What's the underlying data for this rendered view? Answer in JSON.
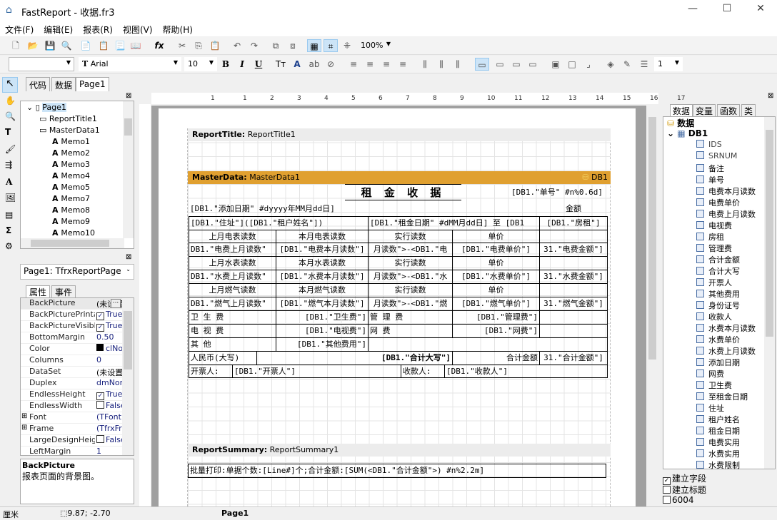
{
  "window": {
    "title": "FastReport - 收据.fr3"
  },
  "menu": [
    "文件(F)",
    "编辑(E)",
    "报表(R)",
    "视图(V)",
    "帮助(H)"
  ],
  "toolbar": {
    "zoom": "100%",
    "font_name": "Arial",
    "font_size": "10",
    "frame_width": "1",
    "style_value": ""
  },
  "doc_tabs": [
    "代码",
    "数据",
    "Page1"
  ],
  "tree": {
    "items": [
      "Page1",
      "ReportTitle1",
      "MasterData1",
      "Memo1",
      "Memo2",
      "Memo3",
      "Memo4",
      "Memo5",
      "Memo7",
      "Memo8",
      "Memo9",
      "Memo10"
    ]
  },
  "object_selector": "Page1: TfrxReportPage",
  "inspector": {
    "tabs": [
      "属性",
      "事件"
    ],
    "rows": [
      {
        "n": "BackPicture",
        "v": "(未设置)",
        "kind": "btn"
      },
      {
        "n": "BackPicturePrintable",
        "v": "True",
        "kind": "check",
        "checked": true
      },
      {
        "n": "BackPictureVisible",
        "v": "True",
        "kind": "check",
        "checked": true
      },
      {
        "n": "BottomMargin",
        "v": "0.50"
      },
      {
        "n": "Color",
        "v": "clNone",
        "kind": "color"
      },
      {
        "n": "Columns",
        "v": "0"
      },
      {
        "n": "DataSet",
        "v": "(未设置)"
      },
      {
        "n": "Duplex",
        "v": "dmNone"
      },
      {
        "n": "EndlessHeight",
        "v": "True",
        "kind": "check",
        "checked": true
      },
      {
        "n": "EndlessWidth",
        "v": "False",
        "kind": "check",
        "checked": false
      },
      {
        "n": "Font",
        "v": "(TFont)",
        "kind": "expand"
      },
      {
        "n": "Frame",
        "v": "(TfrxFrame)",
        "kind": "expand"
      },
      {
        "n": "LargeDesignHeight",
        "v": "False",
        "kind": "check",
        "checked": false
      },
      {
        "n": "LeftMargin",
        "v": "1"
      }
    ],
    "desc_title": "BackPicture",
    "desc_text": "报表页面的背景图。"
  },
  "ruler": [
    "1",
    "1",
    "2",
    "3",
    "4",
    "5",
    "6",
    "7",
    "8",
    "9",
    "10",
    "11",
    "12",
    "13",
    "14",
    "15",
    "16",
    "17"
  ],
  "bands": {
    "title_kind": "ReportTitle:",
    "title_name": "ReportTitle1",
    "master_kind": "MasterData:",
    "master_name": "MasterData1",
    "master_dataset": "DB1",
    "summary_kind": "ReportSummary:",
    "summary_name": "ReportSummary1",
    "master_color": "#e0a030"
  },
  "report": {
    "title": "租 金 收 据",
    "no": "[DB1.\"单号\" #n%0.6d]",
    "date": "[DB1.\"添加日期\" #dyyyy年MM月dd日]",
    "amount_label": "金额",
    "address": "[DB1.\"住址\"]([DB1.\"租户姓名\"])",
    "period": "[DB1.\"租金日期\" #dMM月dd日] 至 [DB1",
    "rent": "[DB1.\"房租\"]",
    "h_e1": "上月电表读数",
    "h_e2": "本月电表读数",
    "h_e3": "实行读数",
    "h_e4": "单价",
    "e1": "DB1.\"电费上月读数\"",
    "e2": "[DB1.\"电费本月读数\"]",
    "e3": "月读数\">-<DB1.\"电",
    "e4": "[DB1.\"电费单价\"]",
    "e5": "31.\"电费金额\"]",
    "h_w1": "上月水表读数",
    "h_w2": "本月水表读数",
    "h_w3": "实行读数",
    "h_w4": "单价",
    "w1": "DB1.\"水费上月读数\"",
    "w2": "[DB1.\"水费本月读数\"]",
    "w3": "月读数\">-<DB1.\"水",
    "w4": "[DB1.\"水费单价\"]",
    "w5": "31.\"水费金额\"]",
    "h_g1": "上月燃气读数",
    "h_g2": "本月燃气读数",
    "h_g3": "实行读数",
    "h_g4": "单价",
    "g1": "DB1.\"燃气上月读数\"",
    "g2": "[DB1.\"燃气本月读数\"]",
    "g3": "月读数\">-<DB1.\"燃",
    "g4": "[DB1.\"燃气单价\"]",
    "g5": "31.\"燃气金额\"]",
    "sanitation_label": "卫 生 费",
    "sanitation": "[DB1.\"卫生费\"]",
    "mgmt_label": "管 理 费",
    "mgmt": "[DB1.\"管理费\"]",
    "tv_label": "电 视 费",
    "tv": "[DB1.\"电视费\"]",
    "net_label": "网     费",
    "net": "[DB1.\"网费\"]",
    "other_label": "其    他",
    "other": "[DB1.\"其他费用\"]",
    "rmb_label": "人民币(大写)",
    "total_words": "[DB1.\"合计大写\"]",
    "total_label": "合计金额",
    "total": "31.\"合计金额\"]",
    "issuer_label": "开票人:",
    "issuer": "[DB1.\"开票人\"]",
    "payee_label": "收款人:",
    "payee": "[DB1.\"收款人\"]",
    "summary": "批量打印:单据个数:[Line#]个;合计金额:[SUM(<DB1.\"合计金额\">) #n%2.2m]"
  },
  "right_panel": {
    "tabs": [
      "数据",
      "变量",
      "函数",
      "类"
    ],
    "root": "数据",
    "db": "DB1",
    "fields": [
      "IDS",
      "SRNUM",
      "备注",
      "单号",
      "电费本月读数",
      "电费单价",
      "电费上月读数",
      "电视费",
      "房租",
      "管理费",
      "合计金额",
      "合计大写",
      "开票人",
      "其他费用",
      "身份证号",
      "收款人",
      "水费本月读数",
      "水费单价",
      "水费上月读数",
      "添加日期",
      "网费",
      "卫生费",
      "至租金日期",
      "住址",
      "租户姓名",
      "租金日期",
      "电费实用",
      "水费实用",
      "水费限制"
    ],
    "options": [
      {
        "label": "建立字段",
        "checked": true
      },
      {
        "label": "建立标题",
        "checked": false
      },
      {
        "label": "6004",
        "checked": false
      }
    ]
  },
  "status": {
    "units": "厘米",
    "coords": "9.87; -2.70",
    "page": "Page1"
  }
}
